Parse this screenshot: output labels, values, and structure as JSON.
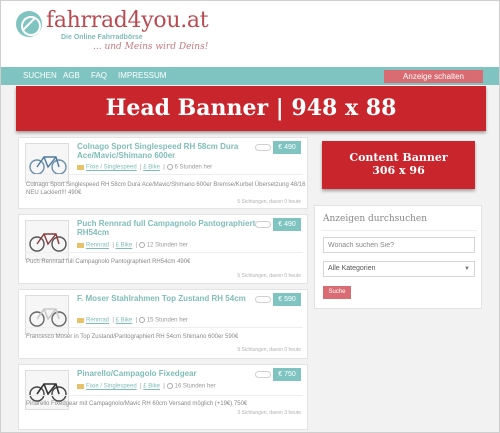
{
  "header": {
    "logo_text": "fahrrad4you.at",
    "logo_sub": "Die Online Fahrradbörse",
    "logo_slogan": "... und Meins wird Deins!"
  },
  "nav": {
    "items": [
      "SUCHEN",
      "AGB",
      "FAQ",
      "IMPRESSUM"
    ],
    "cta": "Anzeige schalten"
  },
  "head_banner": "Head Banner | 948 x 88",
  "content_banner": {
    "line1": "Content Banner",
    "line2": "306 x 96"
  },
  "listings": [
    {
      "title": "Colnago Sport Singlespeed RH 58cm Dura Ace/Mavic/Shimano 600er",
      "price": "€ 490",
      "category": "Fixie / Singlespeed",
      "city": "£ Bike",
      "time": "6 Stunden her",
      "desc": "Colnago Sport Singlespeed RH 58cm Dura Ace/Mavic/Shimano 600er Bremse/Kurbel Übersetzung 48/16 NEU Lackiert!!! 490€",
      "stats": "5 Sichtungen, davon 0 heute"
    },
    {
      "title": "Puch Rennrad full Campagnolo Pantographiert RH54cm",
      "price": "€ 490",
      "category": "Rennrad",
      "city": "£ Bike",
      "time": "12 Stunden her",
      "desc": "Puch Rennrad full Campagnolo Pantographiert RH54cm 490€",
      "stats": "5 Sichtungen, davon 0 heute"
    },
    {
      "title": "F. Moser Stahlrahmen Top Zustand RH 54cm",
      "price": "€ 590",
      "category": "Rennrad",
      "city": "£ Bike",
      "time": "15 Stunden her",
      "desc": "Francesco Moser in Top Zustand/Pantographiert RH 54cm Shimano 600er 590€",
      "stats": "9 Sichtungen, davon 0 heute"
    },
    {
      "title": "Pinarello/Campagolo Fixedgear",
      "price": "€ 750",
      "category": "Fixie / Singlespeed",
      "city": "£ Bike",
      "time": "16 Stunden her",
      "desc": "Pinarello Fixedgear mit Campagnolo/Mavic RH 60cm Versand möglich (+19€) 750€",
      "stats": "3 Sichtungen, davon 3 heute"
    }
  ],
  "search": {
    "title": "Anzeigen durchsuchen",
    "placeholder": "Wonach suchen Sie?",
    "category_selected": "Alle Kategorien",
    "button": "Suche"
  },
  "colors": {
    "accent_teal": "#7fc4c0",
    "accent_red": "#c8262c",
    "button_pink": "#d96c73",
    "logo_red": "#b84a4f"
  }
}
